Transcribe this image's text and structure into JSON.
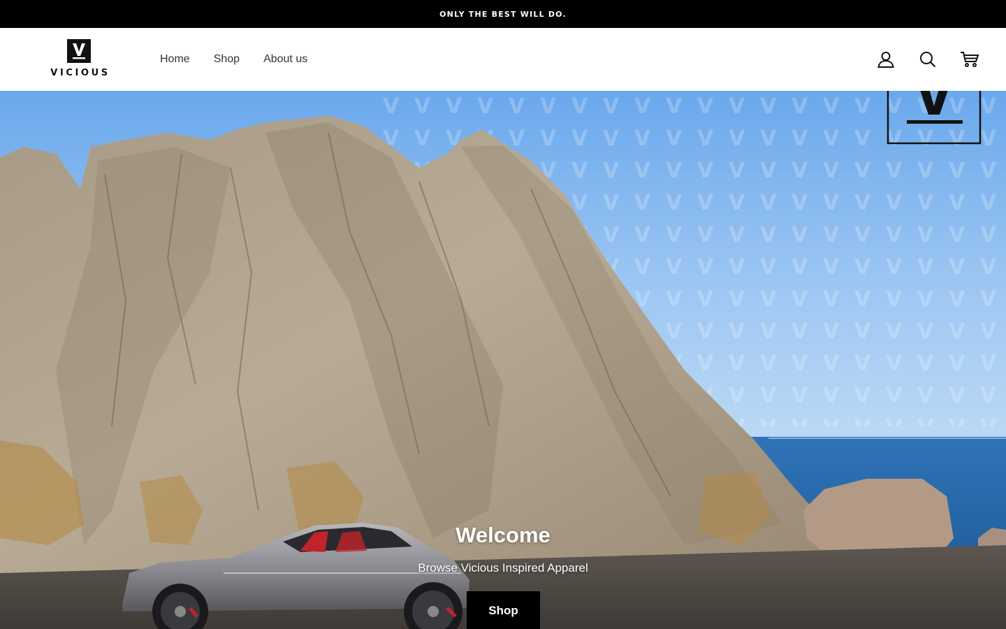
{
  "announcement": {
    "text": "ONLY THE BEST WILL DO."
  },
  "brand": {
    "logo_letter": "V",
    "name": "VICIOUS"
  },
  "nav": {
    "items": [
      {
        "label": "Home"
      },
      {
        "label": "Shop"
      },
      {
        "label": "About us"
      }
    ]
  },
  "header_icons": [
    "account-icon",
    "search-icon",
    "cart-icon"
  ],
  "hero": {
    "title": "Welcome",
    "subtitle": "Browse Vicious Inspired Apparel",
    "button_label": "Shop",
    "watermark_letter": "V"
  },
  "colors": {
    "announcement_bg": "#000000",
    "button_bg": "#000000",
    "sky": "#7fb4ea",
    "sea": "#2e6fb0"
  }
}
